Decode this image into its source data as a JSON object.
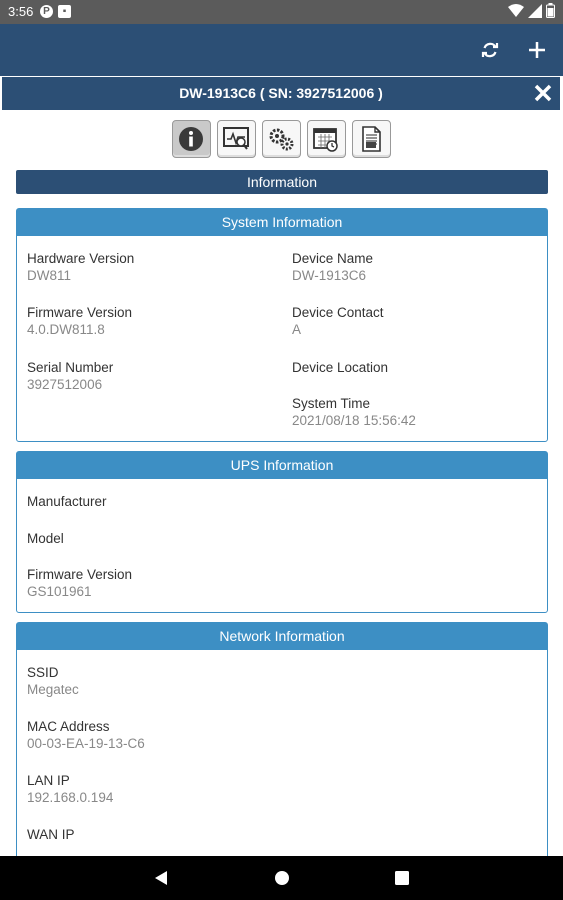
{
  "status_bar": {
    "time": "3:56"
  },
  "dialog": {
    "title": "DW-1913C6 ( SN: 3927512006 )",
    "section_title": "Information"
  },
  "toolbar": {
    "buttons": [
      {
        "icon": "info-icon"
      },
      {
        "icon": "monitor-icon"
      },
      {
        "icon": "settings-gears-icon"
      },
      {
        "icon": "schedule-calendar-icon"
      },
      {
        "icon": "log-document-icon"
      }
    ]
  },
  "system_info": {
    "header": "System Information",
    "hardware_version_label": "Hardware Version",
    "hardware_version": "DW811",
    "firmware_version_label": "Firmware Version",
    "firmware_version": "4.0.DW811.8",
    "serial_number_label": "Serial Number",
    "serial_number": "3927512006",
    "device_name_label": "Device Name",
    "device_name": "DW-1913C6",
    "device_contact_label": "Device Contact",
    "device_contact": "A",
    "device_location_label": "Device Location",
    "system_time_label": "System Time",
    "system_time": "2021/08/18 15:56:42"
  },
  "ups_info": {
    "header": "UPS Information",
    "manufacturer_label": "Manufacturer",
    "model_label": "Model",
    "firmware_version_label": "Firmware Version",
    "firmware_version": "GS101961"
  },
  "network_info": {
    "header": "Network Information",
    "ssid_label": "SSID",
    "ssid": "Megatec",
    "mac_label": "MAC Address",
    "mac": "00-03-EA-19-13-C6",
    "lan_ip_label": "LAN IP",
    "lan_ip": "192.168.0.194",
    "wan_ip_label": "WAN IP"
  },
  "colors": {
    "primary": "#2c4f75",
    "accent": "#3d8fc4"
  }
}
